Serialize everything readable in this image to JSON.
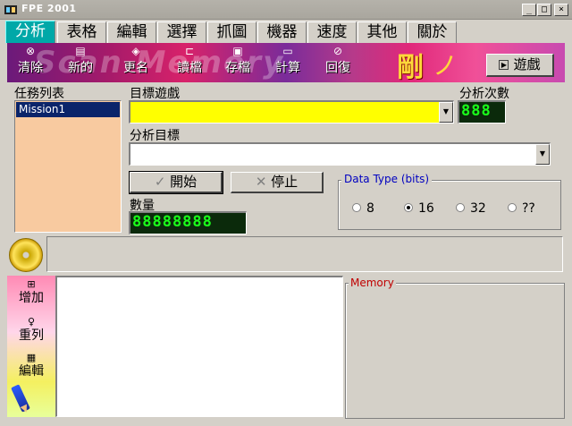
{
  "window": {
    "title": "FPE 2001",
    "buttons": {
      "minimize": "_",
      "maximize": "□",
      "close": "×"
    }
  },
  "tabs": [
    {
      "label": "分析",
      "active": true
    },
    {
      "label": "表格",
      "active": false
    },
    {
      "label": "編輯",
      "active": false
    },
    {
      "label": "選擇",
      "active": false
    },
    {
      "label": "抓圖",
      "active": false
    },
    {
      "label": "機器",
      "active": false
    },
    {
      "label": "速度",
      "active": false
    },
    {
      "label": "其他",
      "active": false
    },
    {
      "label": "關於",
      "active": false
    }
  ],
  "toolbar": {
    "watermark": "Scan Memory",
    "deco_char": "剛",
    "deco_stroke": "ノ",
    "buttons": [
      {
        "label": "清除",
        "icon": "clear-icon"
      },
      {
        "label": "新的",
        "icon": "new-icon"
      },
      {
        "label": "更名",
        "icon": "rename-icon"
      },
      {
        "label": "讀檔",
        "icon": "open-folder-icon"
      },
      {
        "label": "存檔",
        "icon": "save-disk-icon"
      },
      {
        "label": "計算",
        "icon": "calculator-icon"
      },
      {
        "label": "回復",
        "icon": "undo-icon"
      }
    ],
    "game_button": "遊戲"
  },
  "task_list": {
    "label": "任務列表",
    "items": [
      "Mission1"
    ]
  },
  "target_game": {
    "label": "目標遊戲",
    "value": ""
  },
  "analysis_count": {
    "label": "分析次數",
    "display": "888"
  },
  "analysis_target": {
    "label": "分析目標",
    "value": ""
  },
  "actions": {
    "start": "開始",
    "stop": "停止"
  },
  "quantity": {
    "label": "數量",
    "display": "88888888"
  },
  "data_type": {
    "title": "Data Type (bits)",
    "options": [
      {
        "label": "8",
        "selected": false
      },
      {
        "label": "16",
        "selected": true
      },
      {
        "label": "32",
        "selected": false
      },
      {
        "label": "??",
        "selected": false
      }
    ]
  },
  "side_tools": [
    {
      "label": "增加",
      "icon": "add-icon"
    },
    {
      "label": "重列",
      "icon": "relist-icon"
    },
    {
      "label": "編輯",
      "icon": "edit-icon"
    }
  ],
  "memory": {
    "title": "Memory"
  },
  "colors": {
    "active_tab": "#00a8a8",
    "target_combo_bg": "#ffff00",
    "task_list_bg": "#f8caa0",
    "led_text": "#1aff1a",
    "datatype_title": "#0000c0",
    "memory_title": "#c00000"
  }
}
